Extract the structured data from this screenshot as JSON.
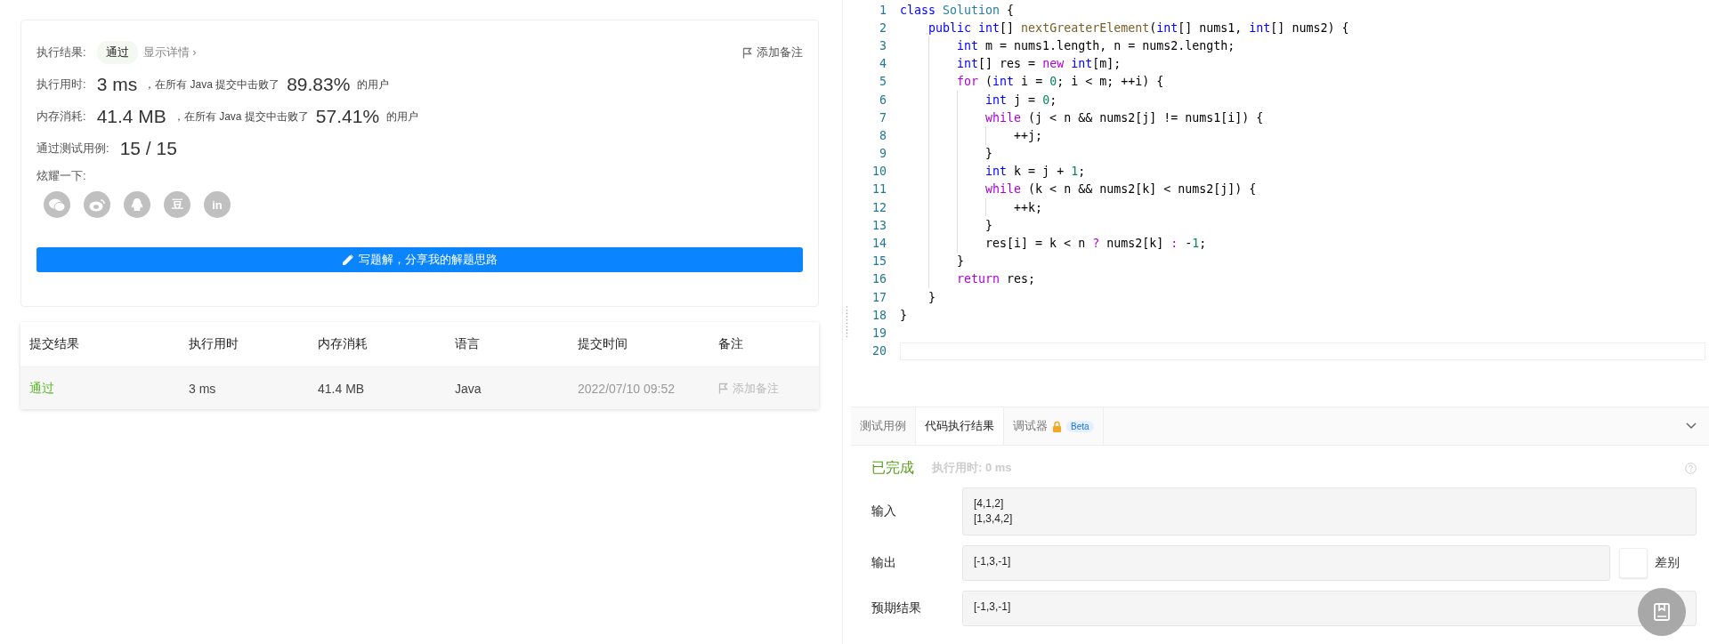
{
  "result_card": {
    "result_label": "执行结果:",
    "result_badge": "通过",
    "details_link": "显示详情 ›",
    "note_link": "添加备注",
    "stats": [
      {
        "label": "执行用时:",
        "value": "3 ms",
        "middle": "，在所有 Java 提交中击败了",
        "percent": "89.83%",
        "suffix": "的用户"
      },
      {
        "label": "内存消耗:",
        "value": "41.4 MB",
        "middle": "，在所有 Java 提交中击败了",
        "percent": "57.41%",
        "suffix": "的用户"
      }
    ],
    "tests_label": "通过测试用例:",
    "tests_value": "15 / 15",
    "share_label": "炫耀一下:",
    "share_icons": [
      {
        "kind": "chat"
      },
      {
        "kind": "swirl"
      },
      {
        "kind": "penguin"
      },
      {
        "kind": "text",
        "label": "豆"
      },
      {
        "kind": "text",
        "label": "in"
      }
    ],
    "write_button": "写题解，分享我的解题思路"
  },
  "submissions": {
    "columns": [
      "提交结果",
      "执行用时",
      "内存消耗",
      "语言",
      "提交时间",
      "备注"
    ],
    "rows": [
      {
        "status": "通过",
        "time": "3 ms",
        "memory": "41.4 MB",
        "language": "Java",
        "submitted": "2022/07/10 09:52",
        "note": "添加备注"
      }
    ]
  },
  "editor": {
    "lines": [
      {
        "number": "1",
        "tokens": [
          {
            "text": "class ",
            "kind": "kw"
          },
          {
            "text": "Solution",
            "kind": "type"
          },
          {
            "text": " {",
            "kind": "plain"
          }
        ]
      },
      {
        "number": "2",
        "tokens": [
          {
            "text": "    public int",
            "kind": "kw"
          },
          {
            "text": "[] ",
            "kind": "plain"
          },
          {
            "text": "nextGreaterElement",
            "kind": "fn"
          },
          {
            "text": "(",
            "kind": "plain"
          },
          {
            "text": "int",
            "kind": "kw"
          },
          {
            "text": "[] nums1, ",
            "kind": "plain"
          },
          {
            "text": "int",
            "kind": "kw"
          },
          {
            "text": "[] nums2) {",
            "kind": "plain"
          }
        ]
      },
      {
        "number": "3",
        "tokens": [
          {
            "text": "        int",
            "kind": "kw"
          },
          {
            "text": " m = nums1.length, n = nums2.length;",
            "kind": "plain"
          }
        ]
      },
      {
        "number": "4",
        "tokens": [
          {
            "text": "        int",
            "kind": "kw"
          },
          {
            "text": "[] res = ",
            "kind": "plain"
          },
          {
            "text": "new ",
            "kind": "ctrl"
          },
          {
            "text": "int",
            "kind": "kw"
          },
          {
            "text": "[m];",
            "kind": "plain"
          }
        ]
      },
      {
        "number": "5",
        "tokens": [
          {
            "text": "        for",
            "kind": "ctrl"
          },
          {
            "text": " (",
            "kind": "plain"
          },
          {
            "text": "int",
            "kind": "kw"
          },
          {
            "text": " i = ",
            "kind": "plain"
          },
          {
            "text": "0",
            "kind": "num"
          },
          {
            "text": "; i < m; ++i) {",
            "kind": "plain"
          }
        ]
      },
      {
        "number": "6",
        "tokens": [
          {
            "text": "            int",
            "kind": "kw"
          },
          {
            "text": " j = ",
            "kind": "plain"
          },
          {
            "text": "0",
            "kind": "num"
          },
          {
            "text": ";",
            "kind": "plain"
          }
        ]
      },
      {
        "number": "7",
        "tokens": [
          {
            "text": "            while",
            "kind": "ctrl"
          },
          {
            "text": " (j < n && nums2[j] != nums1[i]) {",
            "kind": "plain"
          }
        ]
      },
      {
        "number": "8",
        "tokens": [
          {
            "text": "                ++j;",
            "kind": "plain"
          }
        ]
      },
      {
        "number": "9",
        "tokens": [
          {
            "text": "            }",
            "kind": "plain"
          }
        ]
      },
      {
        "number": "10",
        "tokens": [
          {
            "text": "            int",
            "kind": "kw"
          },
          {
            "text": " k = j + ",
            "kind": "plain"
          },
          {
            "text": "1",
            "kind": "num"
          },
          {
            "text": ";",
            "kind": "plain"
          }
        ]
      },
      {
        "number": "11",
        "tokens": [
          {
            "text": "            while",
            "kind": "ctrl"
          },
          {
            "text": " (k < n && nums2[k] < nums2[j]) {",
            "kind": "plain"
          }
        ]
      },
      {
        "number": "12",
        "tokens": [
          {
            "text": "                ++k;",
            "kind": "plain"
          }
        ]
      },
      {
        "number": "13",
        "tokens": [
          {
            "text": "            }",
            "kind": "plain"
          }
        ]
      },
      {
        "number": "14",
        "tokens": [
          {
            "text": "            res[i] = k < n ",
            "kind": "plain"
          },
          {
            "text": "?",
            "kind": "ctrl"
          },
          {
            "text": " nums2[k] ",
            "kind": "plain"
          },
          {
            "text": ":",
            "kind": "ctrl"
          },
          {
            "text": " -",
            "kind": "plain"
          },
          {
            "text": "1",
            "kind": "num"
          },
          {
            "text": ";",
            "kind": "plain"
          }
        ]
      },
      {
        "number": "15",
        "tokens": [
          {
            "text": "        }",
            "kind": "plain"
          }
        ]
      },
      {
        "number": "16",
        "tokens": [
          {
            "text": "        return",
            "kind": "ctrl"
          },
          {
            "text": " res;",
            "kind": "plain"
          }
        ]
      },
      {
        "number": "17",
        "tokens": [
          {
            "text": "    }",
            "kind": "plain"
          }
        ]
      },
      {
        "number": "18",
        "tokens": [
          {
            "text": "}",
            "kind": "plain"
          }
        ]
      },
      {
        "number": "19"
      },
      {
        "number": "20",
        "current": true
      }
    ]
  },
  "console": {
    "tabs": [
      {
        "label": "测试用例",
        "selected": false
      },
      {
        "label": "代码执行结果",
        "selected": true
      },
      {
        "label": "调试器",
        "selected": false,
        "locked": true,
        "badge": "Beta"
      }
    ],
    "status": "已完成",
    "runtime": "执行用时: 0 ms",
    "input_label": "输入",
    "input_lines": [
      "[4,1,2]",
      "[1,3,4,2]"
    ],
    "output_label": "输出",
    "output_value": "[-1,3,-1]",
    "diff_label": "差别",
    "diff_on": false,
    "expected_label": "预期结果",
    "expected_value": "[-1,3,-1]"
  }
}
